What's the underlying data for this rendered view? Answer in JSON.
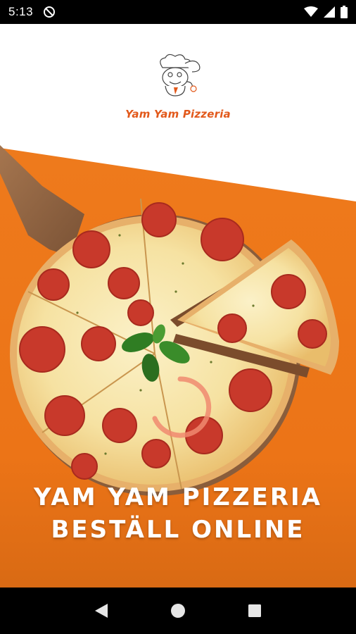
{
  "status_bar": {
    "time": "5:13",
    "icons": [
      "sync-disabled-icon",
      "wifi-icon",
      "cellular-signal-icon",
      "battery-icon"
    ]
  },
  "brand": {
    "logo_text": "Yam Yam Pizzeria",
    "logo_icon": "chef-mascot-icon",
    "accent_color": "#e2591b",
    "orange_color": "#ee7a1c"
  },
  "splash": {
    "headline_line1": "YAM YAM PIZZERIA",
    "headline_line2": "BESTÄLL ONLINE",
    "loading_indicator": "circular-progress-icon"
  },
  "nav_bar": {
    "buttons": [
      "back-triangle-icon",
      "home-circle-icon",
      "recents-square-icon"
    ]
  }
}
